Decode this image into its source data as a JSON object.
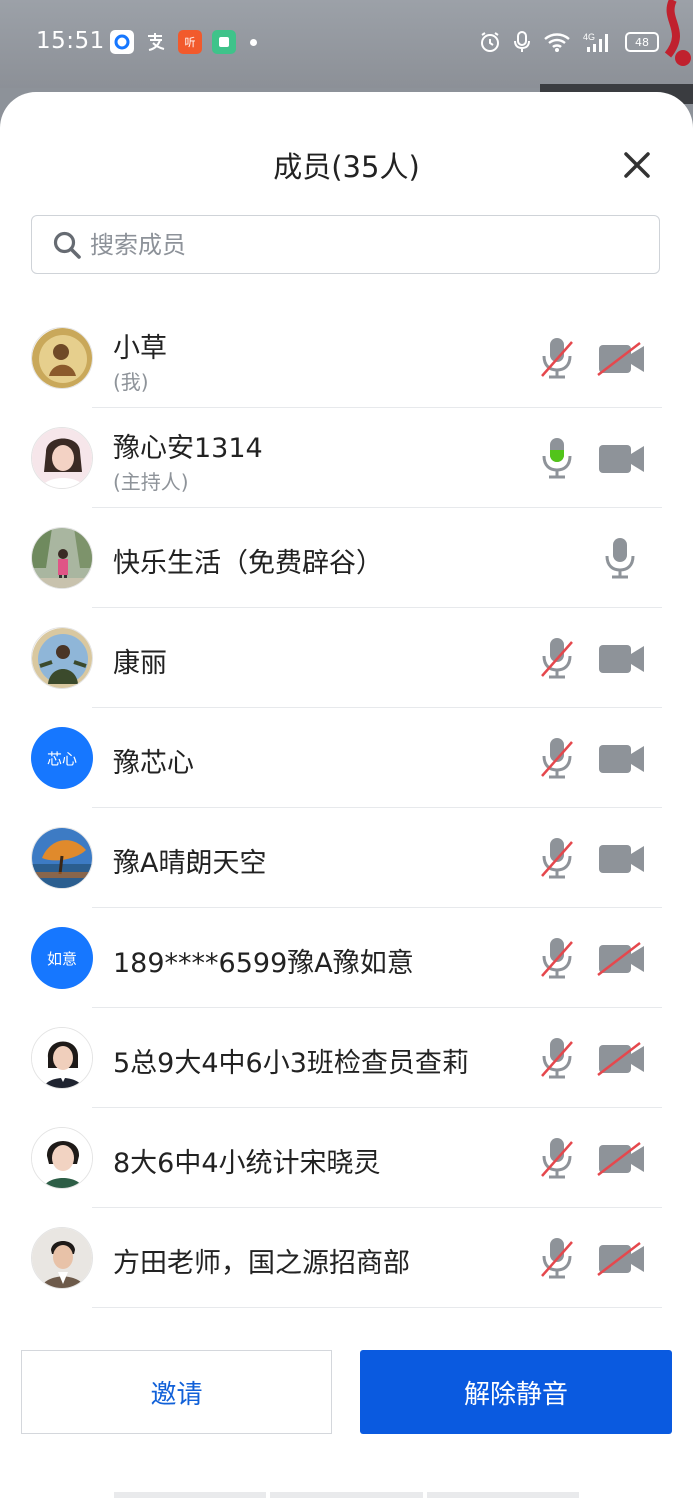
{
  "status_bar": {
    "time": "15:51",
    "battery": "48",
    "left_icons": [
      "browser-icon",
      "alipay-icon",
      "listen-app-icon",
      "app-icon"
    ],
    "right_icons": [
      "alarm-icon",
      "mic-icon",
      "wifi-icon",
      "signal-4g-icon",
      "battery-icon"
    ]
  },
  "header": {
    "title": "成员(35人)"
  },
  "search": {
    "placeholder": "搜索成员",
    "value": ""
  },
  "members": [
    {
      "name": "小草",
      "sub": "(我)",
      "avatar": "photo",
      "mic": "muted",
      "cam": "off"
    },
    {
      "name": "豫心安1314",
      "sub": "(主持人)",
      "avatar": "photo",
      "mic": "active",
      "cam": "on"
    },
    {
      "name": "快乐生活（免费辟谷）",
      "sub": "",
      "avatar": "photo",
      "mic": "on",
      "cam": "none"
    },
    {
      "name": "康丽",
      "sub": "",
      "avatar": "photo",
      "mic": "muted",
      "cam": "on"
    },
    {
      "name": "豫芯心",
      "sub": "",
      "avatar": "text",
      "avatar_text": "芯心",
      "mic": "muted",
      "cam": "on"
    },
    {
      "name": "豫A晴朗天空",
      "sub": "",
      "avatar": "photo",
      "mic": "muted",
      "cam": "on"
    },
    {
      "name": "189****6599豫A豫如意",
      "sub": "",
      "avatar": "text",
      "avatar_text": "如意",
      "mic": "muted",
      "cam": "off"
    },
    {
      "name": "5总9大4中6小3班检查员查莉",
      "sub": "",
      "avatar": "photo",
      "mic": "muted",
      "cam": "off"
    },
    {
      "name": "8大6中4小统计宋晓灵",
      "sub": "",
      "avatar": "photo",
      "mic": "muted",
      "cam": "off"
    },
    {
      "name": "方田老师，国之源招商部",
      "sub": "",
      "avatar": "photo",
      "mic": "muted",
      "cam": "off"
    }
  ],
  "footer": {
    "invite_label": "邀请",
    "unmute_label": "解除静音"
  },
  "colors": {
    "primary": "#0a5ae0",
    "mic_active": "#52c41a",
    "mute_slash": "#e5484d",
    "icon_gray": "#8e9399"
  }
}
